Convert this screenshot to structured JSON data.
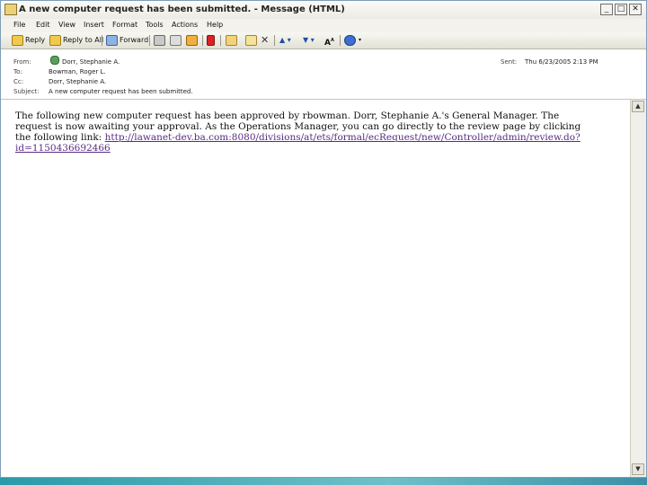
{
  "window": {
    "title": "A new computer request has been submitted. - Message (HTML)",
    "controls": {
      "minimize": "_",
      "maximize": "□",
      "close": "✕"
    }
  },
  "menu": [
    "File",
    "Edit",
    "View",
    "Insert",
    "Format",
    "Tools",
    "Actions",
    "Help"
  ],
  "toolbar": {
    "reply": "Reply",
    "reply_all": "Reply to All",
    "forward": "Forward"
  },
  "header": {
    "from_label": "From:",
    "from_value": "Dorr, Stephanie A.",
    "to_label": "To:",
    "to_value": "Bowman, Roger L.",
    "cc_label": "Cc:",
    "cc_value": "Dorr, Stephanie A.",
    "subject_label": "Subject:",
    "subject_value": "A new computer request has been submitted.",
    "sent_label": "Sent:",
    "sent_value": "Thu 6/23/2005 2:13 PM"
  },
  "body": {
    "text": "The following new computer request has been approved by rbowman. Dorr, Stephanie A.'s General Manager. The request is now awaiting your approval. As the Operations Manager, you can go directly to the review page by clicking the following link: ",
    "link": "http://lawanet-dev.ba.com:8080/divisions/at/ets/formal/ecRequest/new/Controller/admin/review.do?id=1150436692466"
  },
  "colors": {
    "link": "#5a2b86",
    "taskbar": "#2a9aa8"
  }
}
